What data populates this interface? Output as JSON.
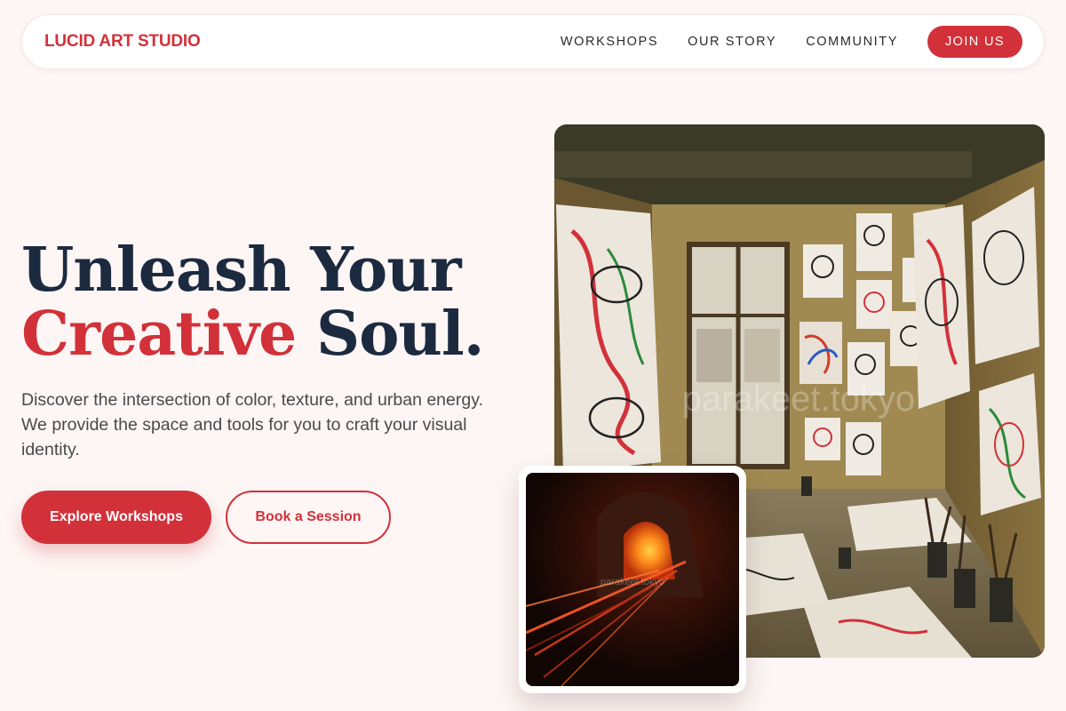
{
  "brand": {
    "name": "LUCID ART STUDIO",
    "color": "#d2313a"
  },
  "nav": {
    "links": [
      "WORKSHOPS",
      "OUR STORY",
      "COMMUNITY"
    ],
    "cta": "JOIN US"
  },
  "hero": {
    "headline_line1": "Unleash Your",
    "headline_accent": "Creative",
    "headline_rest": " Soul.",
    "lead": "Discover the intersection of color, texture, and urban energy. We provide the space and tools for you to craft your visual identity.",
    "primary_button": "Explore Workshops",
    "secondary_button": "Book a Session"
  },
  "images": {
    "main_watermark": "parakeet.tokyo",
    "inset_watermark": "parakeet.tokyo"
  },
  "colors": {
    "accent": "#d2313a",
    "headline": "#1c2a40",
    "background": "#fdf6f5"
  }
}
